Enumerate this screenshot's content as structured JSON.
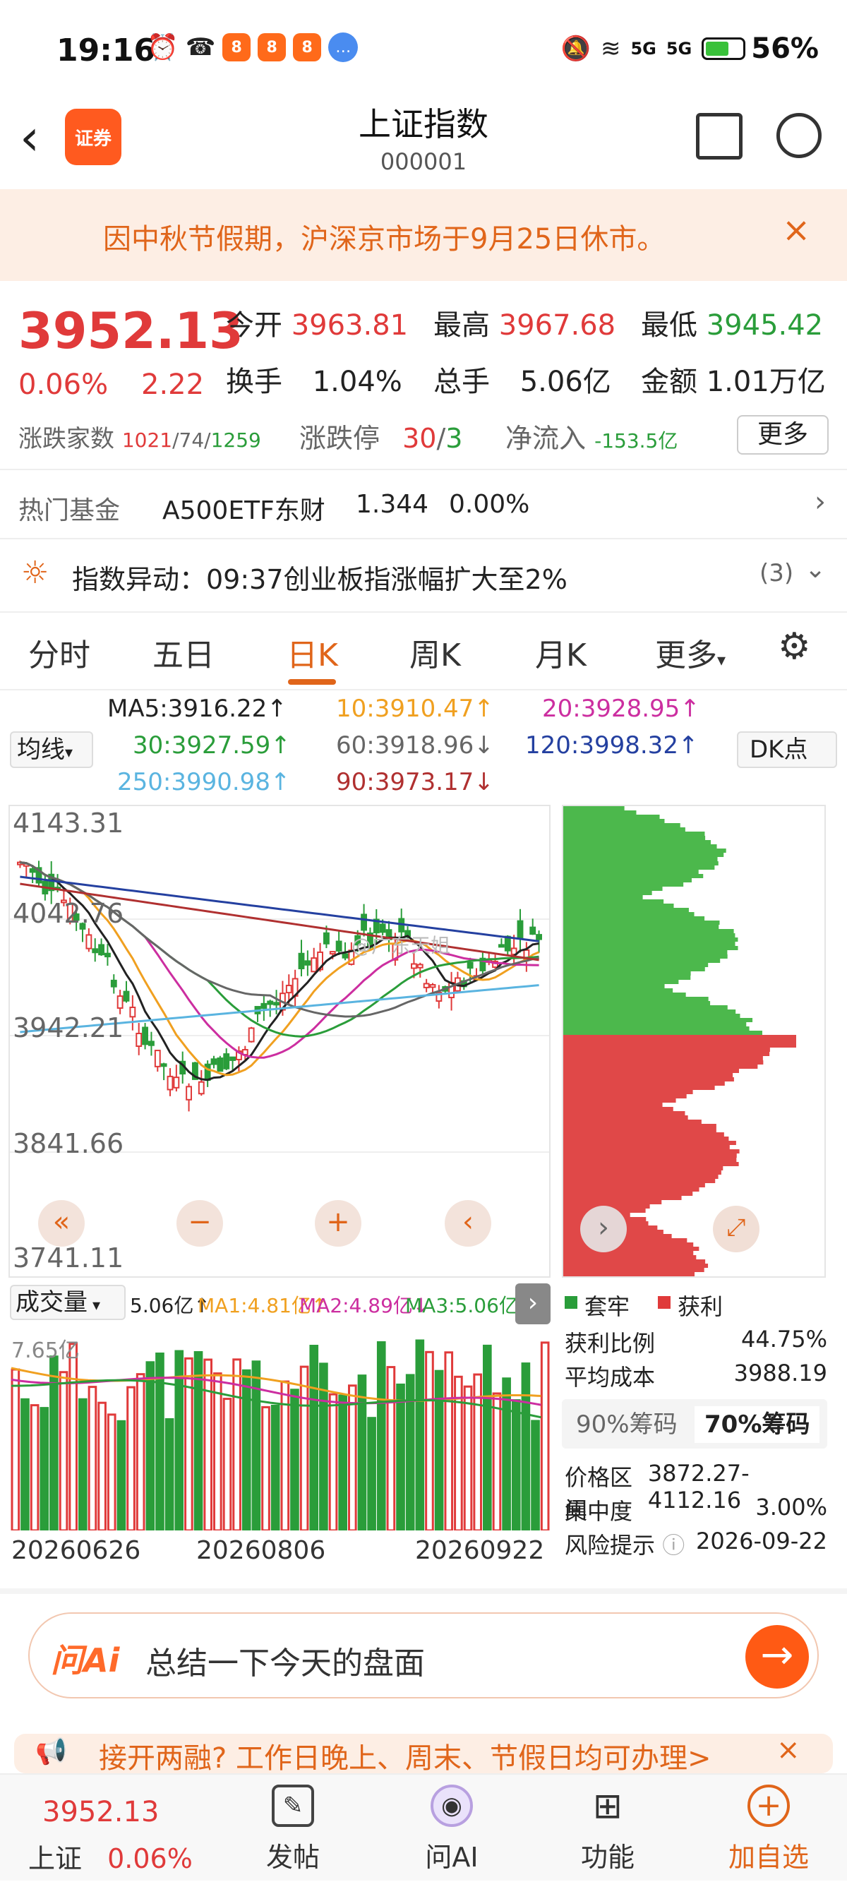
{
  "status_bar": {
    "time": "19:16",
    "network": "5G",
    "network2": "5G",
    "battery": "56%"
  },
  "header": {
    "back": "‹",
    "logo_text": "证券",
    "title": "上证指数",
    "code": "000001"
  },
  "notice": {
    "text": "因中秋节假期，沪深京市场于9月25日休市。",
    "close": "×"
  },
  "quote": {
    "price": "3952.13",
    "change_pct": "0.06%",
    "change": "2.22",
    "open_label": "今开",
    "open": "3963.81",
    "high_label": "最高",
    "high": "3967.68",
    "low_label": "最低",
    "low": "3945.42",
    "turnover_label": "换手",
    "turnover": "1.04%",
    "volume_label": "总手",
    "volume": "5.06亿",
    "amount_label": "金额",
    "amount": "1.01万亿",
    "breadth_label": "涨跌家数",
    "up": "1021",
    "flat": "74",
    "down": "1259",
    "limit_label": "涨跌停",
    "limit_up": "30",
    "limit_down": "3",
    "inflow_label": "净流入",
    "inflow": "-153.5亿",
    "more": "更多"
  },
  "fund": {
    "label": "热门基金",
    "name": "A500ETF东财",
    "price": "1.344",
    "pct": "0.00%"
  },
  "alert": {
    "text": "指数异动：09:37创业板指涨幅扩大至2%",
    "count": "(3)"
  },
  "tabs": [
    "分时",
    "五日",
    "日K",
    "周K",
    "月K",
    "更多"
  ],
  "active_tab": "日K",
  "ma": {
    "ma5": "MA5:3916.22↑",
    "ma10": "10:3910.47↑",
    "ma20": "20:3928.95↑",
    "ma30": "30:3927.59↑",
    "ma60": "60:3918.96↓",
    "ma120": "120:3998.32↑",
    "ma250": "250:3990.98↑",
    "ma90": "90:3973.17↓",
    "selector": "均线",
    "dk": "DK点"
  },
  "chart_axis": {
    "y1": "4143.31",
    "y2": "4042.76",
    "y3": "3942.21",
    "y4": "3841.66",
    "y5": "3741.11",
    "watermark": "@广东天姐"
  },
  "volume_header": {
    "label": "成交量",
    "vol": "5.06亿↑",
    "ma1": "MA1:4.81亿↑",
    "ma2": "MA2:4.89亿↓",
    "ma3": "MA3:5.06亿↑",
    "vmax": "7.65亿"
  },
  "x_labels": [
    "20260626",
    "20260806",
    "20260922"
  ],
  "chip": {
    "legend_trap": "套牢",
    "legend_profit": "获利",
    "profit_ratio_label": "获利比例",
    "profit_ratio": "44.75%",
    "avg_cost_label": "平均成本",
    "avg_cost": "3988.19",
    "tab90": "90%筹码",
    "tab70": "70%筹码",
    "range_label": "价格区间",
    "range": "3872.27-4112.16",
    "conc_label": "集中度",
    "conc": "3.00%",
    "risk_label": "风险提示",
    "risk_date": "2026-09-22"
  },
  "askai": {
    "brand": "问Ai",
    "question": "总结一下今天的盘面"
  },
  "promo": {
    "text": "接开两融? 工作日晚上、周末、节假日均可办理>"
  },
  "bottom_nav": {
    "index_price": "3952.13",
    "index_name": "上证",
    "index_pct": "0.06%",
    "post": "发帖",
    "ai": "问AI",
    "func": "功能",
    "fav": "加自选"
  },
  "colors": {
    "up": "#e03a3a",
    "down": "#2a9d3a",
    "accent": "#e0651a"
  }
}
